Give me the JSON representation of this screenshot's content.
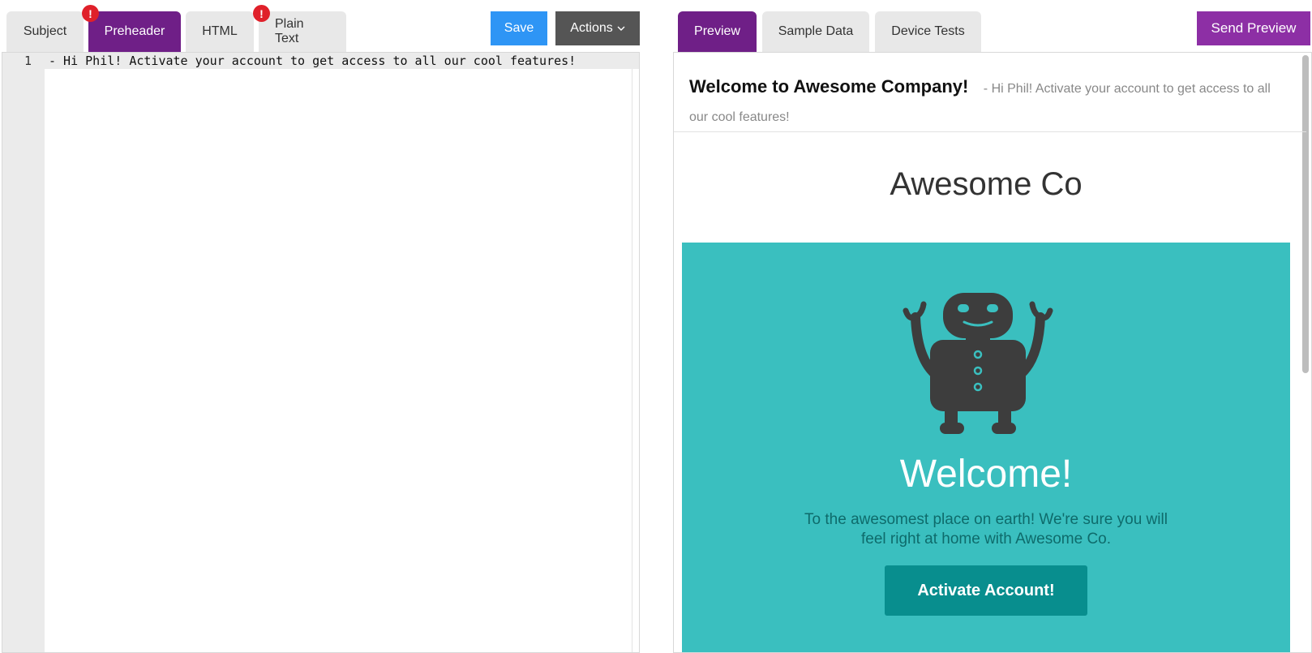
{
  "editor_tabs": [
    {
      "label": "Subject",
      "active": false,
      "error": false
    },
    {
      "label": "Preheader",
      "active": true,
      "error": true
    },
    {
      "label": "HTML",
      "active": false,
      "error": false
    },
    {
      "label": "Plain Text",
      "active": false,
      "error": true
    }
  ],
  "toolbar": {
    "save_label": "Save",
    "actions_label": "Actions",
    "actions_icon": "chevron-down-icon",
    "error_badge": "!"
  },
  "editor": {
    "line_number": "1",
    "line_text": "- Hi Phil! Activate your account to get access to all our cool features!"
  },
  "preview_tabs": [
    {
      "label": "Preview",
      "active": true
    },
    {
      "label": "Sample Data",
      "active": false
    },
    {
      "label": "Device Tests",
      "active": false
    }
  ],
  "send_preview_label": "Send Preview",
  "email": {
    "subject": "Welcome to Awesome Company!",
    "preheader": "- Hi Phil! Activate your account to get access to all our cool features!",
    "brand": "Awesome Co",
    "heading": "Welcome!",
    "body": "To the awesomest place on earth! We're sure you will feel right at home with Awesome Co.",
    "cta_label": "Activate Account!",
    "robot_icon": "robot-icon"
  },
  "colors": {
    "accent_purple": "#6f1f87",
    "save_blue": "#2e95f5",
    "actions_gray": "#555555",
    "send_purple": "#8d2fa5",
    "error_red": "#e0202a",
    "hero_teal": "#3abfbf",
    "cta_teal": "#088e8e",
    "robot_dark": "#3d3d3d"
  }
}
